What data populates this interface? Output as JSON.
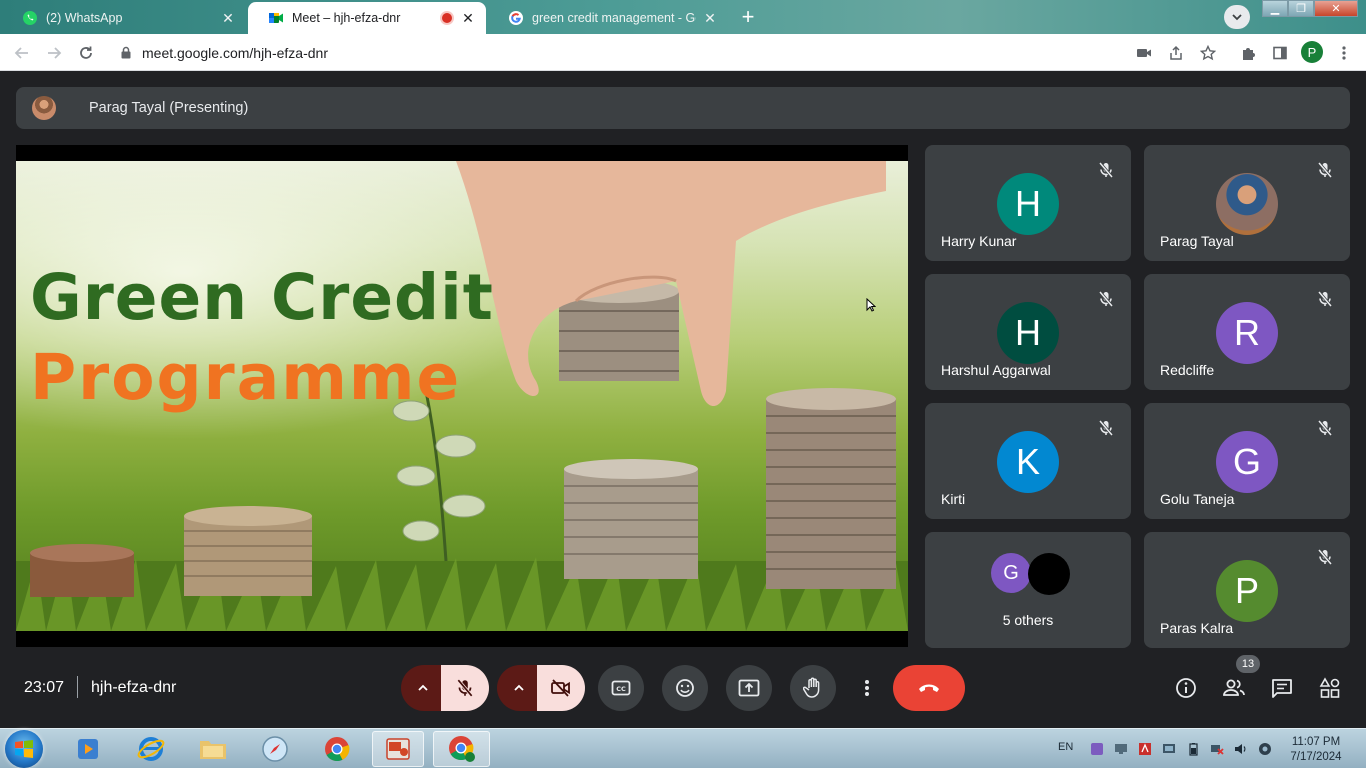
{
  "browser": {
    "tabs": [
      {
        "title": "(2) WhatsApp",
        "favicon": "whatsapp-icon",
        "active": false
      },
      {
        "title": "Meet – hjh-efza-dnr",
        "favicon": "meet-icon",
        "active": true,
        "recording": true
      },
      {
        "title": "green credit management - Goog",
        "favicon": "google-icon",
        "active": false
      }
    ],
    "url": "meet.google.com/hjh-efza-dnr",
    "profile_initial": "P"
  },
  "meet": {
    "presenting_label": "Parag Tayal (Presenting)",
    "slide": {
      "line1": "Green Credit",
      "line2": "Programme"
    },
    "participants": [
      {
        "name": "Harry Kunar",
        "initial": "H",
        "color": "#00897b",
        "muted": true
      },
      {
        "name": "Parag Tayal",
        "initial": "",
        "color": "#8d6e63",
        "muted": true,
        "photo": true
      },
      {
        "name": "Harshul Aggarwal",
        "initial": "H",
        "color": "#004d40",
        "muted": true
      },
      {
        "name": "Redcliffe",
        "initial": "R",
        "color": "#7e57c2",
        "muted": true
      },
      {
        "name": "Kirti",
        "initial": "K",
        "color": "#0288d1",
        "muted": true
      },
      {
        "name": "Golu Taneja",
        "initial": "G",
        "color": "#7e57c2",
        "muted": true
      },
      {
        "name": "Paras Kalra",
        "initial": "P",
        "color": "#558b2f",
        "muted": true
      }
    ],
    "others": {
      "label": "5 others",
      "avatar_initial": "G",
      "avatar_color": "#7e57c2"
    },
    "time": "23:07",
    "meeting_code": "hjh-efza-dnr",
    "participant_count": "13"
  },
  "taskbar": {
    "language": "EN",
    "time": "11:07 PM",
    "date": "7/17/2024"
  }
}
